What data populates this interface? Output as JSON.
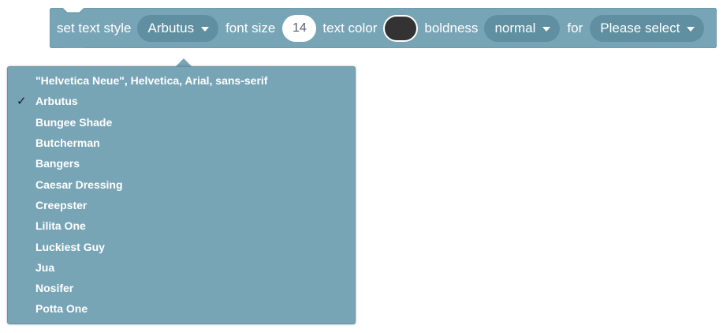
{
  "block": {
    "label_set_text_style": "set text style",
    "font_dropdown_value": "Arbutus",
    "label_font_size": "font size",
    "font_size_value": "14",
    "label_text_color": "text color",
    "text_color_value": "#333333",
    "label_boldness": "boldness",
    "boldness_value": "normal",
    "label_for": "for",
    "target_value": "Please select",
    "block_color": "#78a5b6",
    "field_color": "#5f8fa0"
  },
  "menu": {
    "check_icon": "checkmark-icon",
    "check_glyph": "✓",
    "selected_index": 1,
    "items": [
      "\"Helvetica Neue\", Helvetica, Arial, sans-serif",
      "Arbutus",
      "Bungee Shade",
      "Butcherman",
      "Bangers",
      "Caesar Dressing",
      "Creepster",
      "Lilita One",
      "Luckiest Guy",
      "Jua",
      "Nosifer",
      "Potta One"
    ]
  }
}
